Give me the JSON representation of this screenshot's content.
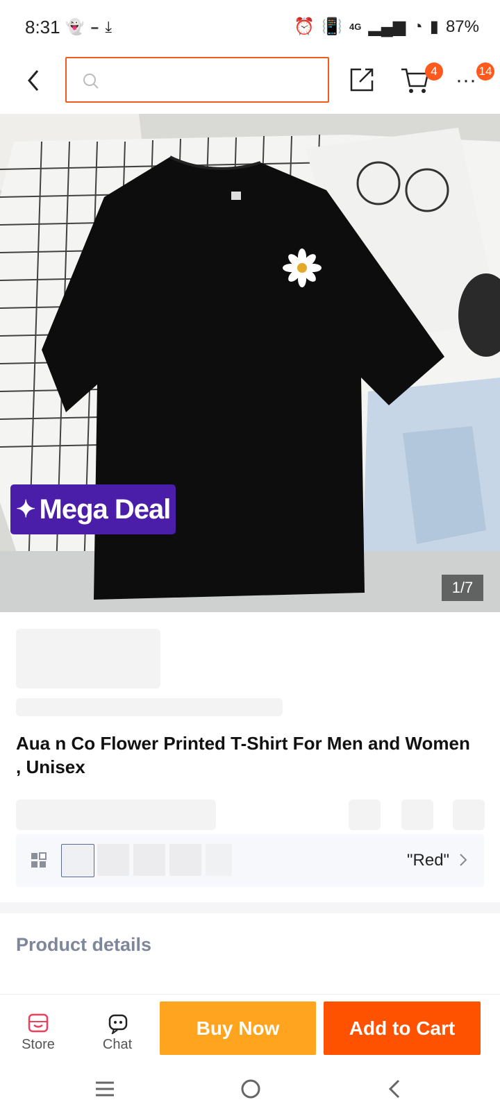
{
  "status_bar": {
    "time": "8:31",
    "battery": "87%",
    "network": "4G"
  },
  "header": {
    "search_placeholder": "",
    "cart_count": "4",
    "more_count": "14"
  },
  "hero": {
    "badge_label": "Mega Deal",
    "image_counter": "1/7"
  },
  "product": {
    "title": "Aua n Co Flower Printed T-Shirt For Men and Women , Unisex",
    "variant_selected": "\"Red\""
  },
  "sections": {
    "product_details": "Product details"
  },
  "bottom_bar": {
    "store_label": "Store",
    "chat_label": "Chat",
    "buy_now_label": "Buy Now",
    "add_to_cart_label": "Add to Cart"
  },
  "colors": {
    "accent": "#fe5200",
    "buy_now": "#fea41e",
    "mega_deal": "#4a1ea8"
  }
}
